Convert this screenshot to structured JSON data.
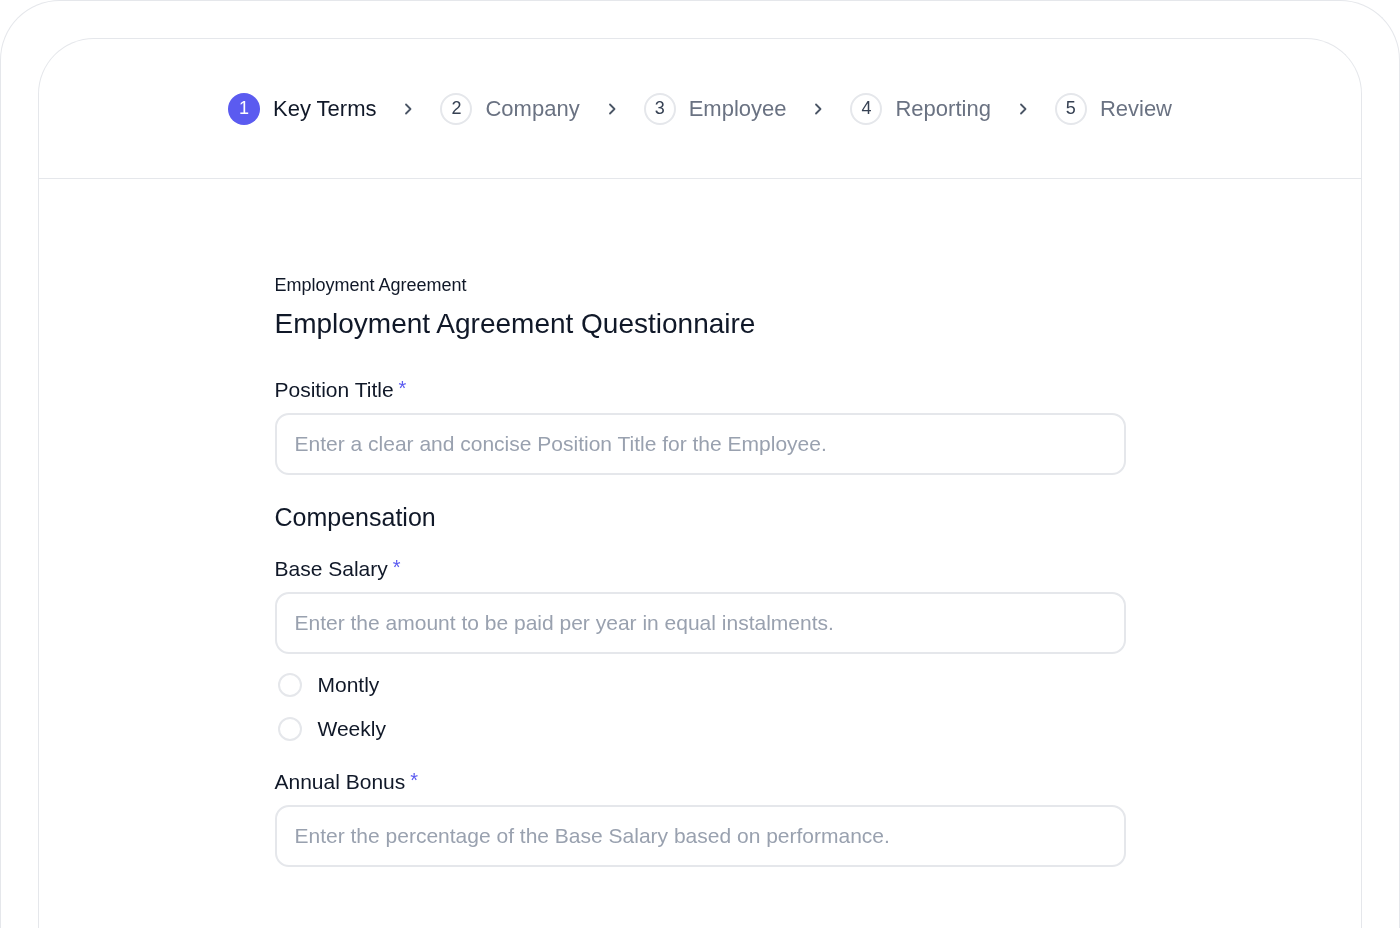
{
  "steps": [
    {
      "number": "1",
      "label": "Key Terms",
      "selected": true
    },
    {
      "number": "2",
      "label": "Company",
      "selected": false
    },
    {
      "number": "3",
      "label": "Employee",
      "selected": false
    },
    {
      "number": "4",
      "label": "Reporting",
      "selected": false
    },
    {
      "number": "5",
      "label": "Review",
      "selected": false
    }
  ],
  "form": {
    "eyebrow": "Employment Agreement",
    "title": "Employment Agreement Questionnaire",
    "items": [
      {
        "kind": "field",
        "label": "Position Title",
        "required": true,
        "required_mark": "*",
        "placeholder": "Enter a clear and concise Position Title for the Employee."
      },
      {
        "kind": "section",
        "label": "Compensation"
      },
      {
        "kind": "field",
        "label": "Base Salary",
        "required": true,
        "required_mark": "*",
        "placeholder": "Enter the amount to be paid per year in equal instalments."
      },
      {
        "kind": "radio",
        "label": "Montly",
        "selected": false
      },
      {
        "kind": "radio",
        "label": "Weekly",
        "selected": false
      },
      {
        "kind": "field",
        "label": "Annual Bonus",
        "required": true,
        "required_mark": "*",
        "placeholder": "Enter the percentage of the Base Salary based on performance."
      }
    ]
  }
}
